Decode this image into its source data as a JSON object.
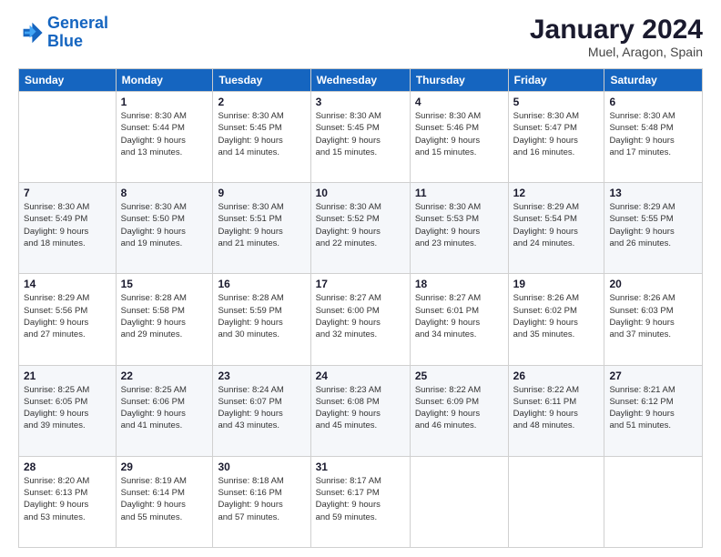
{
  "header": {
    "logo_line1": "General",
    "logo_line2": "Blue",
    "title": "January 2024",
    "subtitle": "Muel, Aragon, Spain"
  },
  "days_of_week": [
    "Sunday",
    "Monday",
    "Tuesday",
    "Wednesday",
    "Thursday",
    "Friday",
    "Saturday"
  ],
  "weeks": [
    [
      {
        "day": null,
        "info": null
      },
      {
        "day": "1",
        "info": "Sunrise: 8:30 AM\nSunset: 5:44 PM\nDaylight: 9 hours\nand 13 minutes."
      },
      {
        "day": "2",
        "info": "Sunrise: 8:30 AM\nSunset: 5:45 PM\nDaylight: 9 hours\nand 14 minutes."
      },
      {
        "day": "3",
        "info": "Sunrise: 8:30 AM\nSunset: 5:45 PM\nDaylight: 9 hours\nand 15 minutes."
      },
      {
        "day": "4",
        "info": "Sunrise: 8:30 AM\nSunset: 5:46 PM\nDaylight: 9 hours\nand 15 minutes."
      },
      {
        "day": "5",
        "info": "Sunrise: 8:30 AM\nSunset: 5:47 PM\nDaylight: 9 hours\nand 16 minutes."
      },
      {
        "day": "6",
        "info": "Sunrise: 8:30 AM\nSunset: 5:48 PM\nDaylight: 9 hours\nand 17 minutes."
      }
    ],
    [
      {
        "day": "7",
        "info": "Sunrise: 8:30 AM\nSunset: 5:49 PM\nDaylight: 9 hours\nand 18 minutes."
      },
      {
        "day": "8",
        "info": "Sunrise: 8:30 AM\nSunset: 5:50 PM\nDaylight: 9 hours\nand 19 minutes."
      },
      {
        "day": "9",
        "info": "Sunrise: 8:30 AM\nSunset: 5:51 PM\nDaylight: 9 hours\nand 21 minutes."
      },
      {
        "day": "10",
        "info": "Sunrise: 8:30 AM\nSunset: 5:52 PM\nDaylight: 9 hours\nand 22 minutes."
      },
      {
        "day": "11",
        "info": "Sunrise: 8:30 AM\nSunset: 5:53 PM\nDaylight: 9 hours\nand 23 minutes."
      },
      {
        "day": "12",
        "info": "Sunrise: 8:29 AM\nSunset: 5:54 PM\nDaylight: 9 hours\nand 24 minutes."
      },
      {
        "day": "13",
        "info": "Sunrise: 8:29 AM\nSunset: 5:55 PM\nDaylight: 9 hours\nand 26 minutes."
      }
    ],
    [
      {
        "day": "14",
        "info": "Sunrise: 8:29 AM\nSunset: 5:56 PM\nDaylight: 9 hours\nand 27 minutes."
      },
      {
        "day": "15",
        "info": "Sunrise: 8:28 AM\nSunset: 5:58 PM\nDaylight: 9 hours\nand 29 minutes."
      },
      {
        "day": "16",
        "info": "Sunrise: 8:28 AM\nSunset: 5:59 PM\nDaylight: 9 hours\nand 30 minutes."
      },
      {
        "day": "17",
        "info": "Sunrise: 8:27 AM\nSunset: 6:00 PM\nDaylight: 9 hours\nand 32 minutes."
      },
      {
        "day": "18",
        "info": "Sunrise: 8:27 AM\nSunset: 6:01 PM\nDaylight: 9 hours\nand 34 minutes."
      },
      {
        "day": "19",
        "info": "Sunrise: 8:26 AM\nSunset: 6:02 PM\nDaylight: 9 hours\nand 35 minutes."
      },
      {
        "day": "20",
        "info": "Sunrise: 8:26 AM\nSunset: 6:03 PM\nDaylight: 9 hours\nand 37 minutes."
      }
    ],
    [
      {
        "day": "21",
        "info": "Sunrise: 8:25 AM\nSunset: 6:05 PM\nDaylight: 9 hours\nand 39 minutes."
      },
      {
        "day": "22",
        "info": "Sunrise: 8:25 AM\nSunset: 6:06 PM\nDaylight: 9 hours\nand 41 minutes."
      },
      {
        "day": "23",
        "info": "Sunrise: 8:24 AM\nSunset: 6:07 PM\nDaylight: 9 hours\nand 43 minutes."
      },
      {
        "day": "24",
        "info": "Sunrise: 8:23 AM\nSunset: 6:08 PM\nDaylight: 9 hours\nand 45 minutes."
      },
      {
        "day": "25",
        "info": "Sunrise: 8:22 AM\nSunset: 6:09 PM\nDaylight: 9 hours\nand 46 minutes."
      },
      {
        "day": "26",
        "info": "Sunrise: 8:22 AM\nSunset: 6:11 PM\nDaylight: 9 hours\nand 48 minutes."
      },
      {
        "day": "27",
        "info": "Sunrise: 8:21 AM\nSunset: 6:12 PM\nDaylight: 9 hours\nand 51 minutes."
      }
    ],
    [
      {
        "day": "28",
        "info": "Sunrise: 8:20 AM\nSunset: 6:13 PM\nDaylight: 9 hours\nand 53 minutes."
      },
      {
        "day": "29",
        "info": "Sunrise: 8:19 AM\nSunset: 6:14 PM\nDaylight: 9 hours\nand 55 minutes."
      },
      {
        "day": "30",
        "info": "Sunrise: 8:18 AM\nSunset: 6:16 PM\nDaylight: 9 hours\nand 57 minutes."
      },
      {
        "day": "31",
        "info": "Sunrise: 8:17 AM\nSunset: 6:17 PM\nDaylight: 9 hours\nand 59 minutes."
      },
      {
        "day": null,
        "info": null
      },
      {
        "day": null,
        "info": null
      },
      {
        "day": null,
        "info": null
      }
    ]
  ]
}
